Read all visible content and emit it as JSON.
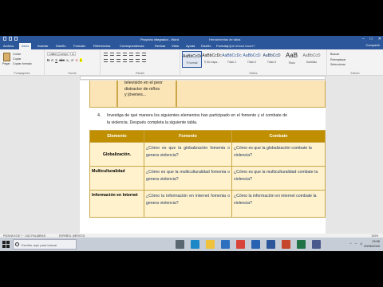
{
  "window": {
    "title": "Proyecto integrador - Word",
    "user": "Herramientas de tabla"
  },
  "tabs": [
    "Archivo",
    "Inicio",
    "Insertar",
    "Diseño",
    "Formato",
    "Referencias",
    "Correspondencia",
    "Revisar",
    "Vista",
    "Ayuda",
    "Diseño",
    "Formato"
  ],
  "tell_me": "¿Qué desea hacer?",
  "share_label": "Compartir",
  "ribbon": {
    "clipboard": {
      "paste": "Pegar",
      "cut": "Cortar",
      "copy": "Copiar",
      "format_painter": "Copiar formato",
      "label": "Portapapeles"
    },
    "font": {
      "name": "Calibri (Cuerpo",
      "size": "11",
      "label": "Fuente",
      "buttons": [
        "N",
        "K",
        "S",
        "abc",
        "x₂",
        "x²",
        "A",
        "A"
      ]
    },
    "paragraph": {
      "label": "Párrafo"
    },
    "styles": {
      "label": "Estilos",
      "items": [
        {
          "sample": "AaBbCcDc",
          "name": "¶ Normal"
        },
        {
          "sample": "AaBbCcDc",
          "name": "¶ Sin espa..."
        },
        {
          "sample": "AaBbCcDc",
          "name": "Título 1"
        },
        {
          "sample": "AaBbCcD",
          "name": "Título 2"
        },
        {
          "sample": "AaBbCcD",
          "name": "Título 3"
        },
        {
          "sample": "AaB",
          "name": "Título"
        },
        {
          "sample": "AaBbCcD",
          "name": "Subtítulo"
        }
      ]
    },
    "editing": {
      "find": "Buscar",
      "replace": "Reemplazar",
      "select": "Seleccionar",
      "label": "Edición"
    }
  },
  "document": {
    "previous_cell_lines": [
      "televisión en el peor",
      "distractor de niños",
      "y jóvenes..."
    ],
    "instruction_number": "4.",
    "instruction": "Investiga de qué manera los siguientes elementos han participado en el fomento y el combate de la violencia. Después completa la siguiente tabla.",
    "table": {
      "headers": [
        "Elemento",
        "Fomento",
        "Combate"
      ],
      "rows": [
        {
          "elemento": "Globalización.",
          "fomento": "¿Cómo es que la globalización fomenta o genera violencia?",
          "combate": "¿Cómo es que la globalización combate la violencia?"
        },
        {
          "elemento": "Multiculturalidad",
          "fomento": "¿Cómo es que la multiculturalidad fomenta o genera violencia?",
          "combate": "¿Cómo es que la multiculturalidad combate la violencia?"
        },
        {
          "elemento": "Información en Internet",
          "fomento": "¿Cómo la información en internet fomenta o genera violencia?",
          "combate": "¿Cómo la información en internet combate la violencia?"
        }
      ]
    }
  },
  "status": {
    "left": "PÁGINA 5 DE 7 · 1312 PALABRAS",
    "mid": "ESPAÑOL (MÉXICO)",
    "zoom": "100%"
  },
  "taskbar": {
    "search_placeholder": "Escribe aquí para buscar",
    "time": "13:56",
    "date": "20/06/2020",
    "apps": [
      {
        "name": "task-view",
        "color": "#5b6770"
      },
      {
        "name": "edge",
        "color": "#1e88c7"
      },
      {
        "name": "explorer",
        "color": "#f0c23b"
      },
      {
        "name": "store",
        "color": "#2e6fc0"
      },
      {
        "name": "chrome",
        "color": "#d9443a"
      },
      {
        "name": "mail",
        "color": "#2a62b3"
      },
      {
        "name": "word",
        "color": "#2b579a"
      },
      {
        "name": "powerpoint",
        "color": "#c5462a"
      },
      {
        "name": "excel",
        "color": "#217346"
      },
      {
        "name": "photos",
        "color": "#4b5a8c"
      }
    ]
  }
}
